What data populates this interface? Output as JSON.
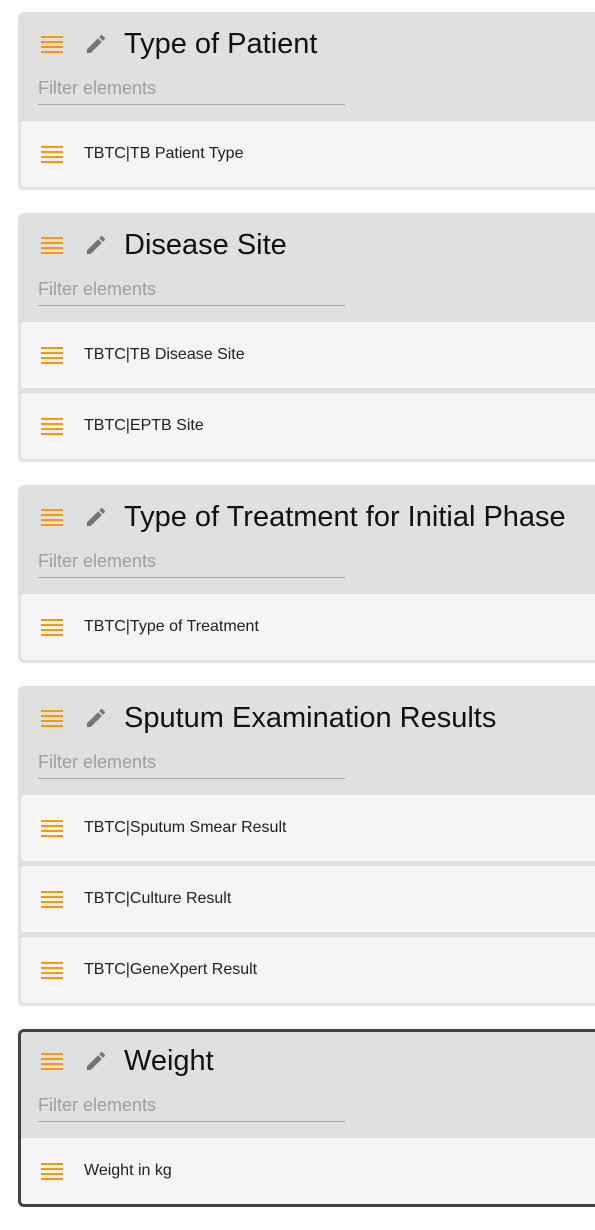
{
  "colors": {
    "accent": "#ff9800",
    "header_bg": "#e0e0e0",
    "item_bg": "#f5f5f5",
    "active_border": "#424242"
  },
  "icons": {
    "drag": "drag-handle-icon",
    "edit": "pencil-icon"
  },
  "sections": [
    {
      "title": "Type of Patient",
      "filter_placeholder": "Filter elements",
      "filter_value": "",
      "active": false,
      "items": [
        {
          "label": "TBTC|TB Patient Type"
        }
      ]
    },
    {
      "title": "Disease Site",
      "filter_placeholder": "Filter elements",
      "filter_value": "",
      "active": false,
      "items": [
        {
          "label": "TBTC|TB Disease Site"
        },
        {
          "label": "TBTC|EPTB Site"
        }
      ]
    },
    {
      "title": "Type of Treatment for Initial Phase",
      "filter_placeholder": "Filter elements",
      "filter_value": "",
      "active": false,
      "items": [
        {
          "label": "TBTC|Type of Treatment"
        }
      ]
    },
    {
      "title": "Sputum Examination Results",
      "filter_placeholder": "Filter elements",
      "filter_value": "",
      "active": false,
      "items": [
        {
          "label": "TBTC|Sputum Smear Result"
        },
        {
          "label": "TBTC|Culture Result"
        },
        {
          "label": "TBTC|GeneXpert Result"
        }
      ]
    },
    {
      "title": "Weight",
      "filter_placeholder": "Filter elements",
      "filter_value": "",
      "active": true,
      "items": [
        {
          "label": "Weight in kg"
        }
      ]
    }
  ]
}
